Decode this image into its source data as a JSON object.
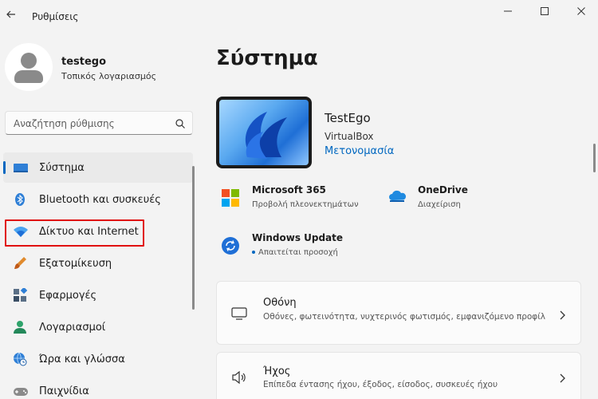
{
  "window": {
    "title": "Ρυθμίσεις"
  },
  "profile": {
    "name": "testego",
    "account_type": "Τοπικός λογαριασμός"
  },
  "search": {
    "placeholder": "Αναζήτηση ρύθμισης"
  },
  "sidebar": {
    "items": [
      {
        "label": "Σύστημα",
        "icon": "system-icon",
        "active": true
      },
      {
        "label": "Bluetooth και συσκευές",
        "icon": "bluetooth-icon",
        "active": false
      },
      {
        "label": "Δίκτυο και Internet",
        "icon": "wifi-icon",
        "active": false,
        "highlighted": true
      },
      {
        "label": "Εξατομίκευση",
        "icon": "paintbrush-icon",
        "active": false
      },
      {
        "label": "Εφαρμογές",
        "icon": "apps-icon",
        "active": false
      },
      {
        "label": "Λογαριασμοί",
        "icon": "person-icon",
        "active": false
      },
      {
        "label": "Ώρα και γλώσσα",
        "icon": "globe-clock-icon",
        "active": false
      },
      {
        "label": "Παιχνίδια",
        "icon": "gamepad-icon",
        "active": false
      }
    ]
  },
  "main": {
    "title": "Σύστημα",
    "device": {
      "name": "TestEgo",
      "model": "VirtualBox",
      "rename_label": "Μετονομασία"
    },
    "tiles": [
      {
        "title": "Microsoft 365",
        "subtitle": "Προβολή πλεονεκτημάτων",
        "icon": "microsoft-logo-icon"
      },
      {
        "title": "OneDrive",
        "subtitle": "Διαχείριση",
        "icon": "onedrive-cloud-icon"
      },
      {
        "title": "Windows Update",
        "subtitle": "Απαιτείται προσοχή",
        "icon": "windows-update-icon"
      }
    ],
    "cards": [
      {
        "title": "Οθόνη",
        "description": "Οθόνες, φωτεινότητα, νυχτερινός φωτισμός, εμφανιζόμενο προφίλ",
        "icon": "monitor-icon"
      },
      {
        "title": "Ήχος",
        "description": "Επίπεδα έντασης ήχου, έξοδος, είσοδος, συσκευές ήχου",
        "icon": "speaker-icon"
      }
    ]
  },
  "colors": {
    "accent": "#0067c0",
    "highlight_border": "#e01010",
    "background": "#f3f3f3"
  }
}
